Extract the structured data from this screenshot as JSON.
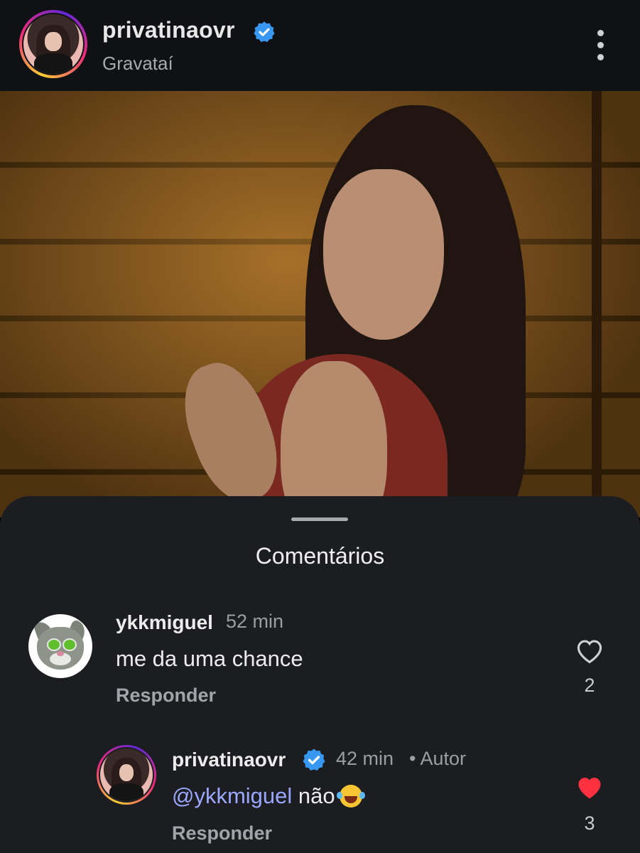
{
  "header": {
    "username": "privatinaovr",
    "location": "Gravataí",
    "more_icon": "more-vertical-icon"
  },
  "post": {
    "image": "photo-of-woman-with-tattoo"
  },
  "comments_sheet": {
    "title": "Comentários",
    "comments": [
      {
        "username": "ykkmiguel",
        "time": "52 min",
        "text": "me da uma chance",
        "reply_label": "Responder",
        "likes": "2",
        "liked": false
      }
    ],
    "replies": [
      {
        "username": "privatinaovr",
        "time": "42 min",
        "author_tag": "• Autor",
        "mention": "@ykkmiguel",
        "text": " não",
        "emoji": "face-with-tears-of-joy",
        "reply_label": "Responder",
        "likes": "3",
        "liked": true
      }
    ]
  },
  "colors": {
    "verified": "#3897f0",
    "heart_liked": "#ff3040",
    "mention": "#9aa7ff",
    "sheet_bg": "#1c1d21"
  }
}
